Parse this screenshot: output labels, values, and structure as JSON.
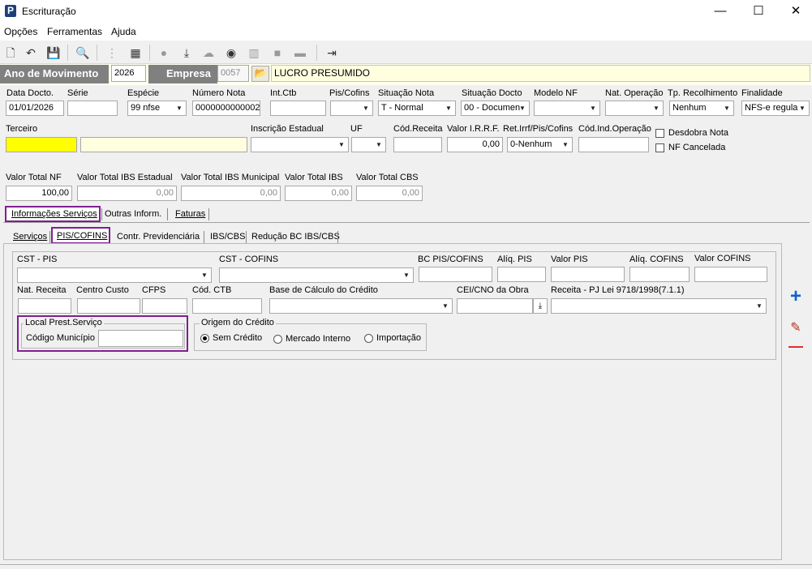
{
  "window": {
    "title": "Escrituração",
    "minimize": "—",
    "maximize": "☐",
    "close": "✕"
  },
  "menu": [
    "Opções",
    "Ferramentas",
    "Ajuda"
  ],
  "header": {
    "ano_label": "Ano de Movimento",
    "ano_value": "2026",
    "empresa_label": "Empresa",
    "empresa_code": "0057",
    "empresa_name": "LUCRO PRESUMIDO"
  },
  "row1": {
    "data_docto": {
      "label": "Data Docto.",
      "value": "01/01/2026"
    },
    "serie": {
      "label": "Série",
      "value": ""
    },
    "especie": {
      "label": "Espécie",
      "value": "99 nfse"
    },
    "numero_nota": {
      "label": "Número Nota",
      "value": "0000000000002"
    },
    "int_ctb": {
      "label": "Int.Ctb",
      "value": ""
    },
    "pis_cofins": {
      "label": "Pis/Cofins",
      "value": ""
    },
    "situacao_nota": {
      "label": "Situação Nota",
      "value": "T - Normal"
    },
    "situacao_docto": {
      "label": "Situação Docto",
      "value": "00 - Documen"
    },
    "modelo_nf": {
      "label": "Modelo NF",
      "value": ""
    },
    "nat_operacao": {
      "label": "Nat. Operação",
      "value": ""
    },
    "tp_recolhimento": {
      "label": "Tp. Recolhimento",
      "value": "Nenhum"
    },
    "finalidade": {
      "label": "Finalidade",
      "value": "NFS-e regula"
    }
  },
  "row2": {
    "terceiro": {
      "label": "Terceiro",
      "code": "",
      "name": ""
    },
    "inscricao_estadual": {
      "label": "Inscrição Estadual",
      "value": ""
    },
    "uf": {
      "label": "UF",
      "value": ""
    },
    "cod_receita": {
      "label": "Cód.Receita",
      "value": ""
    },
    "valor_irrf": {
      "label": "Valor I.R.R.F.",
      "value": "0,00"
    },
    "ret_irrf": {
      "label": "Ret.Irrf/Pis/Cofins",
      "value": "0-Nenhum"
    },
    "cod_ind_operacao": {
      "label": "Cód.Ind.Operação",
      "value": ""
    },
    "desdobra_nota": "Desdobra Nota",
    "nf_cancelada": "NF Cancelada"
  },
  "totals": {
    "valor_total_nf": {
      "label": "Valor Total NF",
      "value": "100,00"
    },
    "ibs_estadual": {
      "label": "Valor Total IBS Estadual",
      "value": "0,00"
    },
    "ibs_municipal": {
      "label": "Valor Total IBS Municipal",
      "value": "0,00"
    },
    "ibs": {
      "label": "Valor Total IBS",
      "value": "0,00"
    },
    "cbs": {
      "label": "Valor Total CBS",
      "value": "0,00"
    }
  },
  "tabs_main": [
    "Informações Serviços",
    "Outras Inform.",
    "Faturas"
  ],
  "tabs_sub": [
    "Serviços",
    "PIS/COFINS",
    "Contr. Previdenciária",
    "IBS/CBS",
    "Redução BC IBS/CBS"
  ],
  "pis": {
    "cst_pis": {
      "label": "CST - PIS",
      "value": ""
    },
    "cst_cofins": {
      "label": "CST - COFINS",
      "value": ""
    },
    "bc_pis_cofins": {
      "label": "BC PIS/COFINS",
      "value": ""
    },
    "aliq_pis": {
      "label": "Alíq. PIS",
      "value": ""
    },
    "valor_pis": {
      "label": "Valor PIS",
      "value": ""
    },
    "aliq_cofins": {
      "label": "Alíq. COFINS",
      "value": ""
    },
    "valor_cofins": {
      "label": "Valor COFINS",
      "value": ""
    },
    "nat_receita": {
      "label": "Nat. Receita",
      "value": ""
    },
    "centro_custo": {
      "label": "Centro Custo",
      "value": ""
    },
    "cfps": {
      "label": "CFPS",
      "value": ""
    },
    "cod_ctb": {
      "label": "Cód. CTB",
      "value": ""
    },
    "base_credito": {
      "label": "Base de Cálculo do Crédito",
      "value": ""
    },
    "cei_cno": {
      "label": "CEI/CNO da Obra",
      "value": ""
    },
    "receita_pj": {
      "label": "Receita - PJ Lei 9718/1998(7.1.1)",
      "value": ""
    },
    "local_prest": {
      "title": "Local Prest.Serviço",
      "cod_municipio_label": "Código Município",
      "cod_municipio_value": ""
    },
    "origem": {
      "title": "Origem do Crédito",
      "options": [
        "Sem Crédito",
        "Mercado Interno",
        "Importação"
      ],
      "selected": "Sem Crédito"
    }
  },
  "side_buttons": {
    "add": "+",
    "edit": "✎",
    "remove": "—"
  },
  "colors": {
    "accent": "#7f1f8f",
    "header_gray": "#808080",
    "yellow": "#ffff00"
  }
}
